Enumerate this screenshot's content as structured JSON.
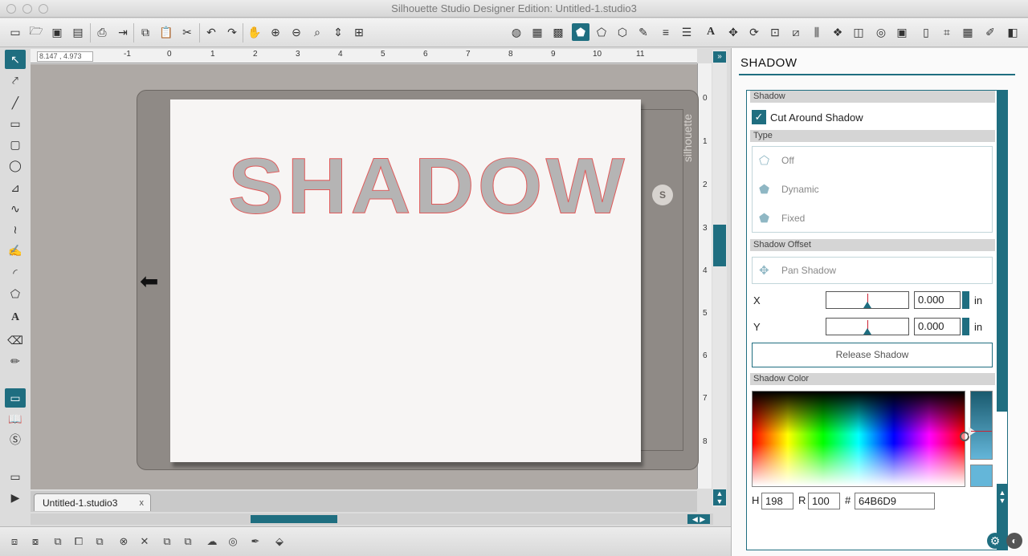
{
  "window": {
    "title": "Silhouette Studio Designer Edition: Untitled-1.studio3"
  },
  "canvas": {
    "coord_readout": "8.147 , 4.973",
    "ruler_h": [
      "-1",
      "0",
      "1",
      "2",
      "3",
      "4",
      "5",
      "6",
      "7",
      "8",
      "9",
      "10",
      "11"
    ],
    "ruler_v": [
      "0",
      "1",
      "2",
      "3",
      "4",
      "5",
      "6",
      "7",
      "8"
    ],
    "design_text": "SHADOW",
    "brand_label": "silhouette",
    "brand_logo": "S"
  },
  "document_tab": {
    "label": "Untitled-1.studio3",
    "close": "x"
  },
  "panel": {
    "title": "SHADOW",
    "shadow_section": "Shadow",
    "cut_around_label": "Cut Around Shadow",
    "cut_around_checked": true,
    "type_section": "Type",
    "type_options": [
      "Off",
      "Dynamic",
      "Fixed"
    ],
    "offset_section": "Shadow Offset",
    "pan_label": "Pan Shadow",
    "x_label": "X",
    "x_value": "0.000",
    "y_label": "Y",
    "y_value": "0.000",
    "unit": "in",
    "release_label": "Release Shadow",
    "color_section": "Shadow Color",
    "h_label": "H",
    "h_value": "198",
    "r_label": "R",
    "r_value": "100",
    "hex_label": "#",
    "hex_value": "64B6D9"
  },
  "colors": {
    "accent": "#1f6e80",
    "shadow_color": "#64B6D9",
    "outline": "#e05a5a"
  }
}
